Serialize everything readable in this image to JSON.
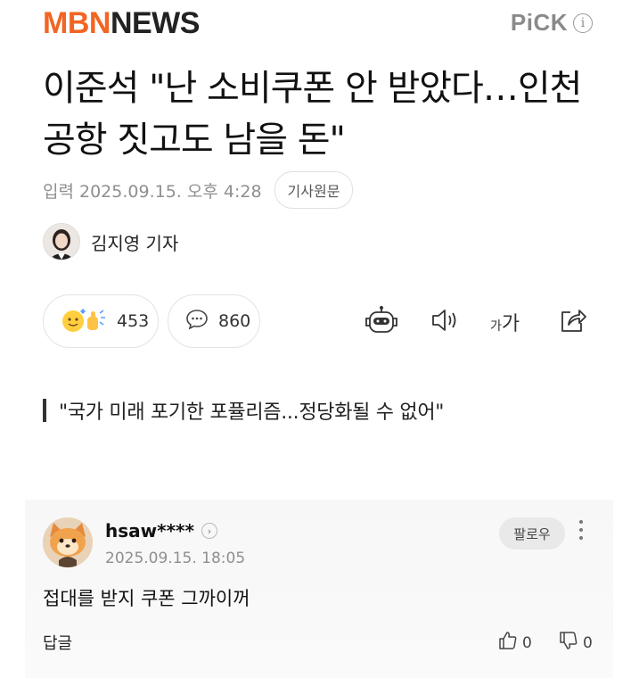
{
  "header": {
    "logo_part1": "MBN",
    "logo_part2": "NEWS",
    "pick_label": "PiCK",
    "info_glyph": "i"
  },
  "article": {
    "title": "이준석 \"난 소비쿠폰 안 받았다…인천공항 짓고도 남을 돈\"",
    "published": "입력 2025.09.15. 오후 4:28",
    "original_button": "기사원문",
    "reporter": "김지영 기자",
    "subheading": "\"국가 미래 포기한 포퓰리즘...정당화될 수 없어\""
  },
  "actions": {
    "reaction_count": "453",
    "comment_count": "860",
    "font_size_small": "가",
    "font_size_large": "가"
  },
  "comment": {
    "username": "hsaw****",
    "timestamp": "2025.09.15. 18:05",
    "follow_label": "팔로우",
    "body": "접대를 받지 쿠폰 그까이꺼",
    "reply_label": "답글",
    "likes": "0",
    "dislikes": "0"
  },
  "colors": {
    "brand_orange": "#f26522",
    "text_gray": "#8f8f8f"
  },
  "icons": [
    "info-icon",
    "reaction-emoji-icon",
    "comment-bubble-icon",
    "robot-summary-icon",
    "speaker-icon",
    "font-size-icon",
    "share-icon",
    "chevron-right-icon",
    "more-vertical-icon",
    "thumbs-up-icon",
    "thumbs-down-icon"
  ]
}
